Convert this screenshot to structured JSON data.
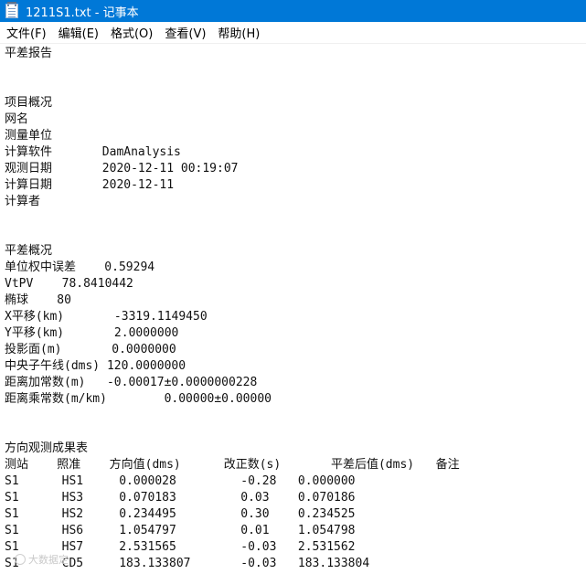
{
  "window": {
    "title": "1211S1.txt - 记事本",
    "icon": "notepad-icon",
    "titlebar_color": "#0078d7"
  },
  "menu": [
    {
      "label": "文件(F)"
    },
    {
      "label": "编辑(E)"
    },
    {
      "label": "格式(O)"
    },
    {
      "label": "查看(V)"
    },
    {
      "label": "帮助(H)"
    }
  ],
  "document": {
    "lines": [
      "平差报告",
      "",
      "",
      "项目概况",
      "网名",
      "测量单位",
      "计算软件       DamAnalysis",
      "观测日期       2020-12-11 00:19:07",
      "计算日期       2020-12-11",
      "计算者",
      "",
      "",
      "平差概况",
      "单位权中误差    0.59294",
      "VtPV    78.8410442",
      "椭球    80",
      "X平移(km)       -3319.1149450",
      "Y平移(km)       2.0000000",
      "投影面(m)       0.0000000",
      "中央子午线(dms) 120.0000000",
      "距离加常数(m)   -0.00017±0.0000000228",
      "距离乘常数(m/km)        0.00000±0.00000",
      "",
      "",
      "方向观测成果表",
      "测站    照准    方向值(dms)      改正数(s)       平差后值(dms)   备注",
      "S1      HS1     0.000028         -0.28   0.000000",
      "S1      HS3     0.070183         0.03    0.070186",
      "S1      HS2     0.234495         0.30    0.234525",
      "S1      HS6     1.054797         0.01    1.054798",
      "S1      HS7     2.531565         -0.03   2.531562",
      "S1      CD5     183.133807       -0.03   183.133804"
    ]
  },
  "watermark": {
    "text": "大数据定"
  }
}
